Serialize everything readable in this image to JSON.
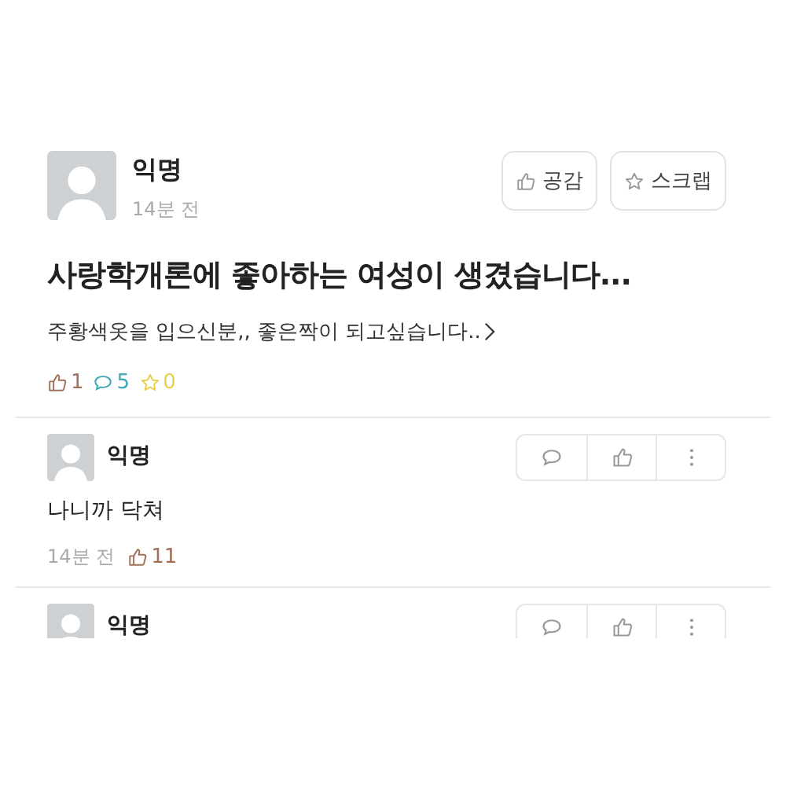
{
  "post": {
    "author": "익명",
    "time": "14분 전",
    "buttons": [
      {
        "kind": "like",
        "label": "공감"
      },
      {
        "kind": "scrap",
        "label": "스크랩"
      }
    ],
    "title": "사랑학개론에 좋아하는 여성이 생겼습니다...",
    "body": "주황색옷을 입으신분,, 좋은짝이 되고싶습니다..",
    "stats": [
      {
        "kind": "like",
        "count": "1"
      },
      {
        "kind": "comment",
        "count": "5"
      },
      {
        "kind": "scrap",
        "count": "0"
      }
    ]
  },
  "comments": [
    {
      "author": "익명",
      "text": "나니까 닥쳐",
      "time": "14분 전",
      "likes": "11"
    },
    {
      "author": "익명"
    }
  ]
}
